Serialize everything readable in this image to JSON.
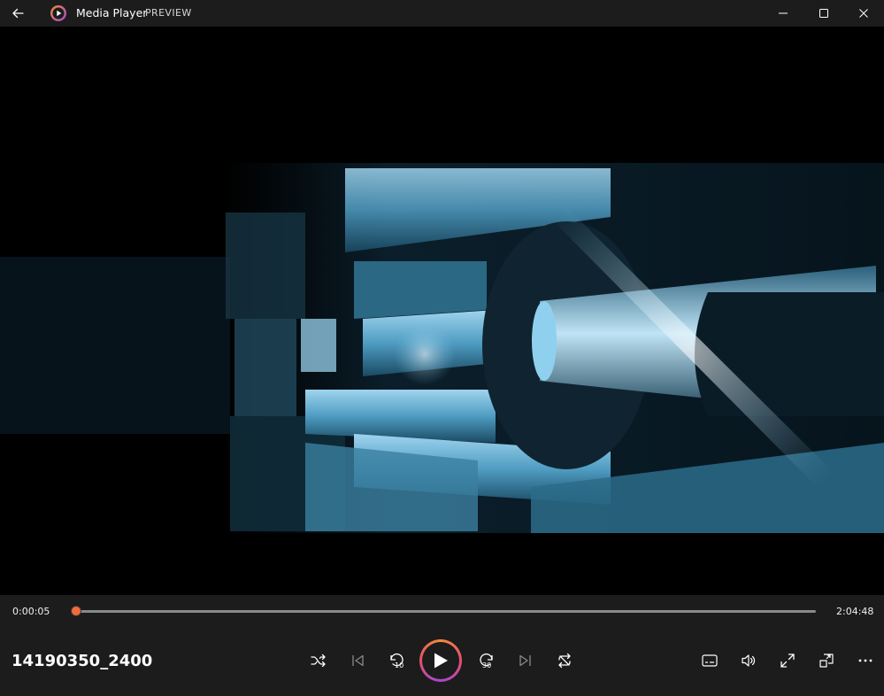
{
  "titlebar": {
    "app_name": "Media Player",
    "badge": "PREVIEW"
  },
  "playback": {
    "current_time": "0:00:05",
    "total_time": "2:04:48",
    "progress_fraction": 0.0007,
    "media_title": "14190350_2400",
    "skip_back_seconds": "10",
    "skip_forward_seconds": "30"
  },
  "colors": {
    "accent": "#f26b3a",
    "chrome": "#1c1c1c",
    "video_tint": "#4f9cc2"
  },
  "icons": {
    "back": "back-arrow-icon",
    "shuffle": "shuffle-icon",
    "previous": "previous-track-icon",
    "skip_back": "skip-back-icon",
    "play": "play-icon",
    "skip_forward": "skip-forward-icon",
    "next": "next-track-icon",
    "repeat": "repeat-icon",
    "captions": "captions-icon",
    "volume": "volume-icon",
    "fullscreen": "fullscreen-icon",
    "miniplayer": "miniplayer-icon",
    "more": "more-icon"
  }
}
